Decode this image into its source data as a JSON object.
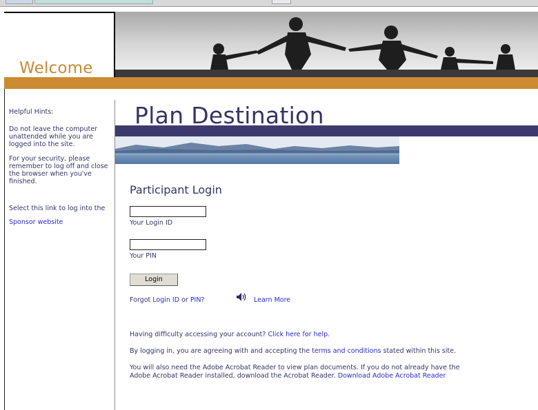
{
  "header": {
    "welcome": "Welcome",
    "plan_title": "Plan Destination"
  },
  "sidebar": {
    "hints_title": "Helpful Hints:",
    "hint_1": "Do not leave the computer unattended while you are logged into the site.",
    "hint_2": "For your security, please remember to log off and close the browser when you've finished.",
    "sponsor_prefix": "Select this link to log into the",
    "sponsor_link": "Sponsor website"
  },
  "login": {
    "title": "Participant Login",
    "login_id_label": "Your Login ID",
    "login_id_value": "",
    "pin_label": "Your PIN",
    "pin_value": "",
    "button": "Login",
    "forgot_prefix": "Forgot",
    "login_id_link": "Login ID",
    "or": "or",
    "pin_link": "PIN?",
    "learn_more": "Learn More"
  },
  "help": {
    "difficulty_prefix": "Having difficulty accessing your account?",
    "difficulty_link": "Click here for help.",
    "terms_prefix": "By logging in, you are agreeing with and accepting the",
    "terms_link": "terms and conditions",
    "terms_suffix": "stated within this site.",
    "acrobat_line1": "You will also need the Adobe Acrobat Reader to view plan documents. If you do not already have the",
    "acrobat_line2": "Adobe Acrobat Reader installed, download the Acrobat Reader.",
    "acrobat_link": "Download Adobe Acrobat Reader"
  },
  "icons": {
    "speaker": "speaker-icon",
    "hero": "family-silhouette-image",
    "lake": "lake-mountains-image"
  },
  "colors": {
    "orange": "#cc8a33",
    "purple": "#3d3a6e",
    "text": "#333366",
    "link": "#2a2acc"
  }
}
